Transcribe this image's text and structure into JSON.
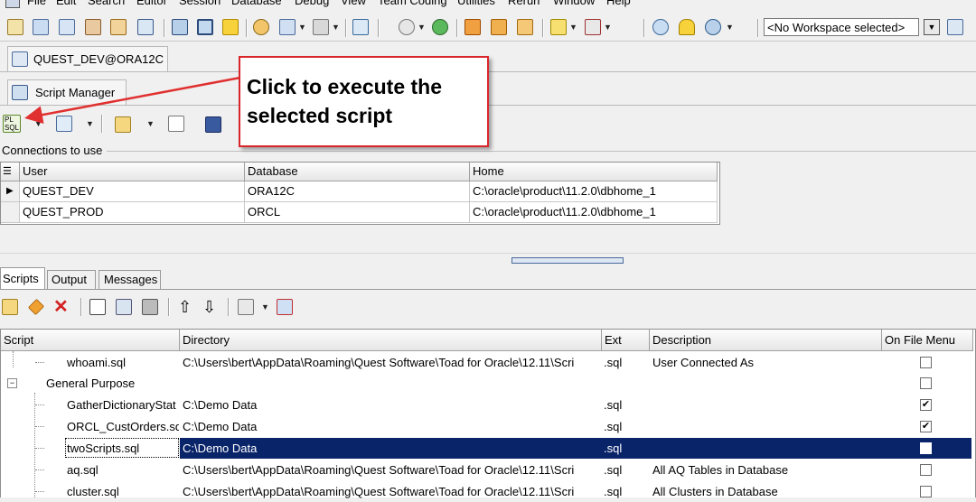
{
  "menu": [
    "File",
    "Edit",
    "Search",
    "Editor",
    "Session",
    "Database",
    "Debug",
    "View",
    "Team Coding",
    "Utilities",
    "Rerun",
    "Window",
    "Help"
  ],
  "workspace": {
    "value": "<No Workspace selected>"
  },
  "connection_tab": {
    "label": "QUEST_DEV@ORA12C"
  },
  "window_tab": {
    "label": "Script Manager"
  },
  "callout": {
    "line1": "Click to execute the",
    "line2": "selected script"
  },
  "connections": {
    "label": "Connections to use",
    "columns": [
      "User",
      "Database",
      "Home"
    ],
    "rows": [
      {
        "user": "QUEST_DEV",
        "database": "ORA12C",
        "home": "C:\\oracle\\product\\11.2.0\\dbhome_1",
        "current": true
      },
      {
        "user": "QUEST_PROD",
        "database": "ORCL",
        "home": "C:\\oracle\\product\\11.2.0\\dbhome_1",
        "current": false
      }
    ]
  },
  "bottom_tabs": [
    "Scripts",
    "Output",
    "Messages"
  ],
  "scripts": {
    "columns": [
      "Script",
      "Directory",
      "Ext",
      "Description",
      "On File Menu"
    ],
    "rows": [
      {
        "script": "whoami.sql",
        "directory": "C:\\Users\\bert\\AppData\\Roaming\\Quest Software\\Toad for Oracle\\12.11\\Scri",
        "ext": ".sql",
        "description": "User Connected As",
        "on_file_menu": false,
        "level": 2,
        "selected": false
      },
      {
        "script": "General Purpose",
        "directory": "",
        "ext": "",
        "description": "",
        "on_file_menu": false,
        "level": 1,
        "selected": false
      },
      {
        "script": "GatherDictionaryStat",
        "directory": "C:\\Demo Data",
        "ext": ".sql",
        "description": "",
        "on_file_menu": true,
        "level": 2,
        "selected": false
      },
      {
        "script": "ORCL_CustOrders.sql",
        "directory": "C:\\Demo Data",
        "ext": ".sql",
        "description": "",
        "on_file_menu": true,
        "level": 2,
        "selected": false
      },
      {
        "script": "twoScripts.sql",
        "directory": "C:\\Demo Data",
        "ext": ".sql",
        "description": "",
        "on_file_menu": false,
        "level": 2,
        "selected": true
      },
      {
        "script": "aq.sql",
        "directory": "C:\\Users\\bert\\AppData\\Roaming\\Quest Software\\Toad for Oracle\\12.11\\Scri",
        "ext": ".sql",
        "description": "All AQ Tables in Database",
        "on_file_menu": false,
        "level": 2,
        "selected": false
      },
      {
        "script": "cluster.sql",
        "directory": "C:\\Users\\bert\\AppData\\Roaming\\Quest Software\\Toad for Oracle\\12.11\\Scri",
        "ext": ".sql",
        "description": "All Clusters in Database",
        "on_file_menu": false,
        "level": 2,
        "selected": false
      }
    ]
  },
  "colors": {
    "selection": "#0a246a",
    "callout_border": "#d9262a",
    "arrow": "#e03030"
  }
}
